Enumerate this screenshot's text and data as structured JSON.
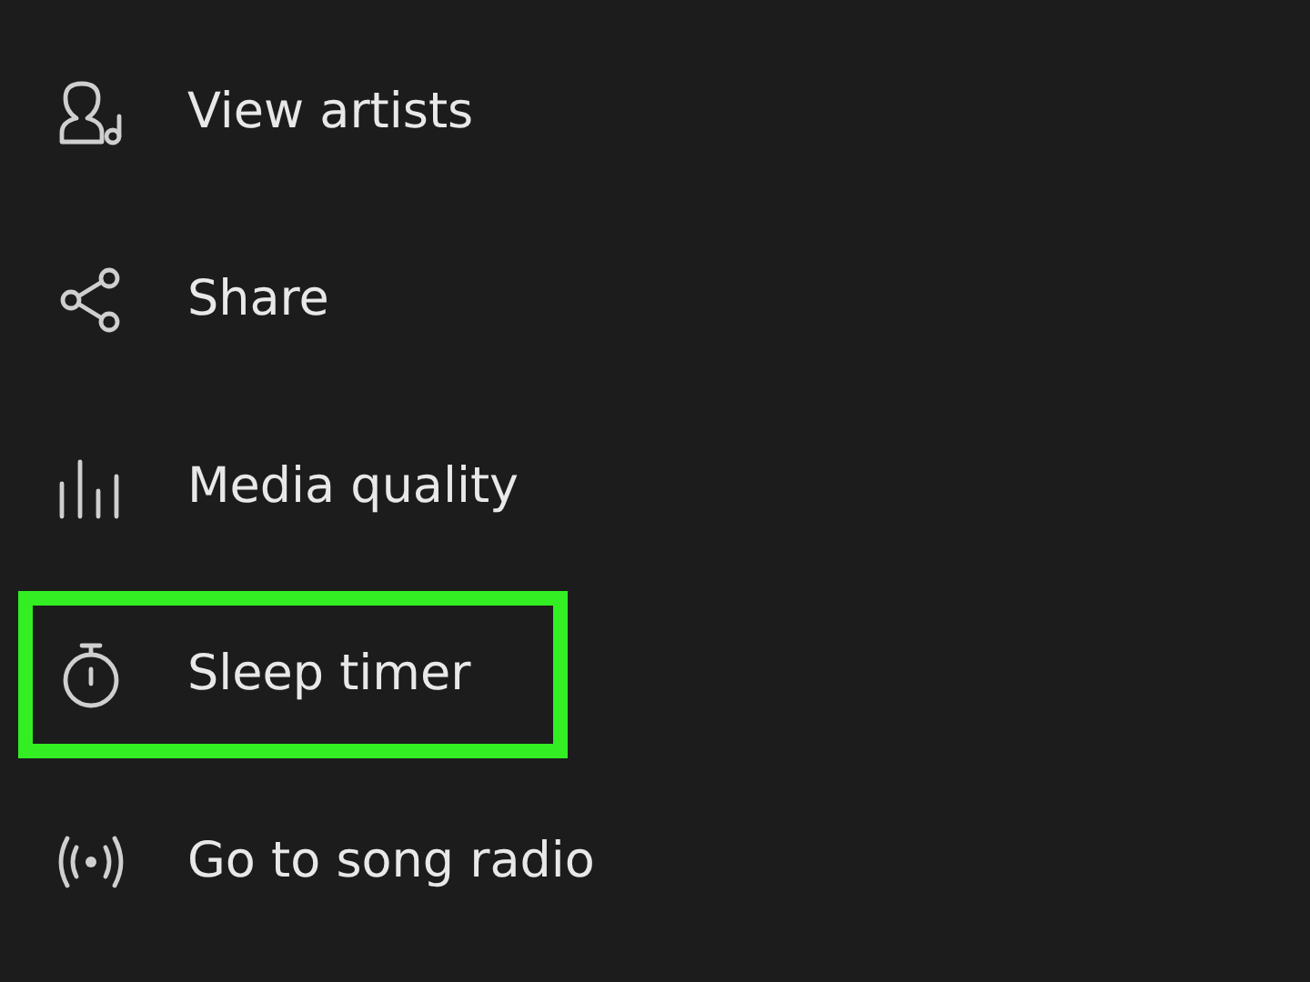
{
  "menu": {
    "items": [
      {
        "kind": "artists",
        "label": "View artists",
        "highlighted": false
      },
      {
        "kind": "share",
        "label": "Share",
        "highlighted": false
      },
      {
        "kind": "quality",
        "label": "Media quality",
        "highlighted": false
      },
      {
        "kind": "timer",
        "label": "Sleep timer",
        "highlighted": true
      },
      {
        "kind": "radio",
        "label": "Go to song radio",
        "highlighted": false
      }
    ]
  }
}
